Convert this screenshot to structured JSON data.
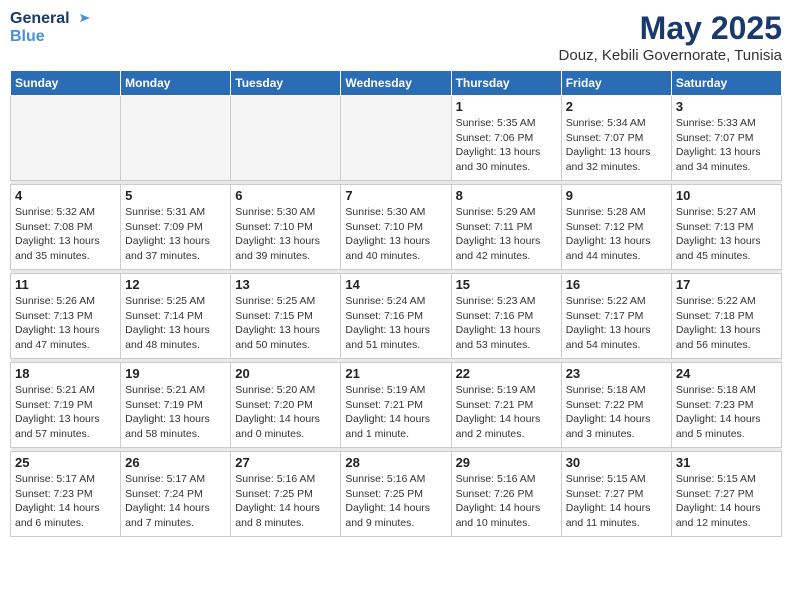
{
  "header": {
    "logo_line1": "General",
    "logo_line2": "Blue",
    "month": "May 2025",
    "location": "Douz, Kebili Governorate, Tunisia"
  },
  "weekdays": [
    "Sunday",
    "Monday",
    "Tuesday",
    "Wednesday",
    "Thursday",
    "Friday",
    "Saturday"
  ],
  "weeks": [
    [
      {
        "day": "",
        "info": ""
      },
      {
        "day": "",
        "info": ""
      },
      {
        "day": "",
        "info": ""
      },
      {
        "day": "",
        "info": ""
      },
      {
        "day": "1",
        "info": "Sunrise: 5:35 AM\nSunset: 7:06 PM\nDaylight: 13 hours\nand 30 minutes."
      },
      {
        "day": "2",
        "info": "Sunrise: 5:34 AM\nSunset: 7:07 PM\nDaylight: 13 hours\nand 32 minutes."
      },
      {
        "day": "3",
        "info": "Sunrise: 5:33 AM\nSunset: 7:07 PM\nDaylight: 13 hours\nand 34 minutes."
      }
    ],
    [
      {
        "day": "4",
        "info": "Sunrise: 5:32 AM\nSunset: 7:08 PM\nDaylight: 13 hours\nand 35 minutes."
      },
      {
        "day": "5",
        "info": "Sunrise: 5:31 AM\nSunset: 7:09 PM\nDaylight: 13 hours\nand 37 minutes."
      },
      {
        "day": "6",
        "info": "Sunrise: 5:30 AM\nSunset: 7:10 PM\nDaylight: 13 hours\nand 39 minutes."
      },
      {
        "day": "7",
        "info": "Sunrise: 5:30 AM\nSunset: 7:10 PM\nDaylight: 13 hours\nand 40 minutes."
      },
      {
        "day": "8",
        "info": "Sunrise: 5:29 AM\nSunset: 7:11 PM\nDaylight: 13 hours\nand 42 minutes."
      },
      {
        "day": "9",
        "info": "Sunrise: 5:28 AM\nSunset: 7:12 PM\nDaylight: 13 hours\nand 44 minutes."
      },
      {
        "day": "10",
        "info": "Sunrise: 5:27 AM\nSunset: 7:13 PM\nDaylight: 13 hours\nand 45 minutes."
      }
    ],
    [
      {
        "day": "11",
        "info": "Sunrise: 5:26 AM\nSunset: 7:13 PM\nDaylight: 13 hours\nand 47 minutes."
      },
      {
        "day": "12",
        "info": "Sunrise: 5:25 AM\nSunset: 7:14 PM\nDaylight: 13 hours\nand 48 minutes."
      },
      {
        "day": "13",
        "info": "Sunrise: 5:25 AM\nSunset: 7:15 PM\nDaylight: 13 hours\nand 50 minutes."
      },
      {
        "day": "14",
        "info": "Sunrise: 5:24 AM\nSunset: 7:16 PM\nDaylight: 13 hours\nand 51 minutes."
      },
      {
        "day": "15",
        "info": "Sunrise: 5:23 AM\nSunset: 7:16 PM\nDaylight: 13 hours\nand 53 minutes."
      },
      {
        "day": "16",
        "info": "Sunrise: 5:22 AM\nSunset: 7:17 PM\nDaylight: 13 hours\nand 54 minutes."
      },
      {
        "day": "17",
        "info": "Sunrise: 5:22 AM\nSunset: 7:18 PM\nDaylight: 13 hours\nand 56 minutes."
      }
    ],
    [
      {
        "day": "18",
        "info": "Sunrise: 5:21 AM\nSunset: 7:19 PM\nDaylight: 13 hours\nand 57 minutes."
      },
      {
        "day": "19",
        "info": "Sunrise: 5:21 AM\nSunset: 7:19 PM\nDaylight: 13 hours\nand 58 minutes."
      },
      {
        "day": "20",
        "info": "Sunrise: 5:20 AM\nSunset: 7:20 PM\nDaylight: 14 hours\nand 0 minutes."
      },
      {
        "day": "21",
        "info": "Sunrise: 5:19 AM\nSunset: 7:21 PM\nDaylight: 14 hours\nand 1 minute."
      },
      {
        "day": "22",
        "info": "Sunrise: 5:19 AM\nSunset: 7:21 PM\nDaylight: 14 hours\nand 2 minutes."
      },
      {
        "day": "23",
        "info": "Sunrise: 5:18 AM\nSunset: 7:22 PM\nDaylight: 14 hours\nand 3 minutes."
      },
      {
        "day": "24",
        "info": "Sunrise: 5:18 AM\nSunset: 7:23 PM\nDaylight: 14 hours\nand 5 minutes."
      }
    ],
    [
      {
        "day": "25",
        "info": "Sunrise: 5:17 AM\nSunset: 7:23 PM\nDaylight: 14 hours\nand 6 minutes."
      },
      {
        "day": "26",
        "info": "Sunrise: 5:17 AM\nSunset: 7:24 PM\nDaylight: 14 hours\nand 7 minutes."
      },
      {
        "day": "27",
        "info": "Sunrise: 5:16 AM\nSunset: 7:25 PM\nDaylight: 14 hours\nand 8 minutes."
      },
      {
        "day": "28",
        "info": "Sunrise: 5:16 AM\nSunset: 7:25 PM\nDaylight: 14 hours\nand 9 minutes."
      },
      {
        "day": "29",
        "info": "Sunrise: 5:16 AM\nSunset: 7:26 PM\nDaylight: 14 hours\nand 10 minutes."
      },
      {
        "day": "30",
        "info": "Sunrise: 5:15 AM\nSunset: 7:27 PM\nDaylight: 14 hours\nand 11 minutes."
      },
      {
        "day": "31",
        "info": "Sunrise: 5:15 AM\nSunset: 7:27 PM\nDaylight: 14 hours\nand 12 minutes."
      }
    ]
  ]
}
